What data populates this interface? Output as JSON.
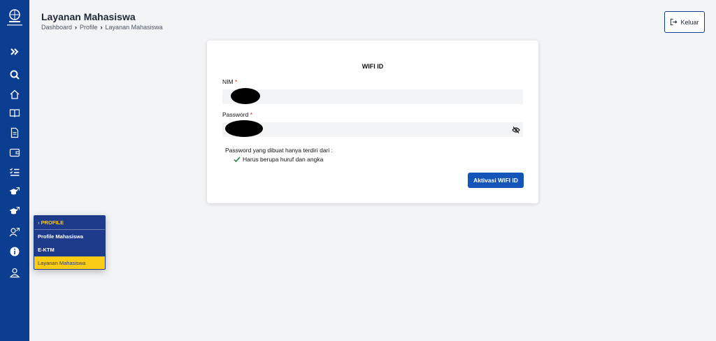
{
  "header": {
    "title": "Layanan Mahasiswa",
    "breadcrumb": [
      "Dashboard",
      "Profile",
      "Layanan Mahasiswa"
    ],
    "logout_label": "Keluar"
  },
  "sidebar": {
    "icons": [
      "expand-icon",
      "search-icon",
      "home-icon",
      "book-icon",
      "document-icon",
      "wallet-icon",
      "checklist-icon",
      "graduation-link-icon",
      "graduation-link-icon",
      "users-link-icon",
      "info-icon",
      "user-icon"
    ]
  },
  "form": {
    "title": "WIFI ID",
    "nim_label": "NIM",
    "password_label": "Password",
    "required_mark": "*",
    "rule_title": "Password yang dibuat hanya terdiri dari :",
    "rule_item": "Harus berupa huruf dan angka",
    "submit_label": "Aktivasi WIFI ID"
  },
  "popup_menu": {
    "header": "› PROFILE",
    "items": [
      {
        "label": "Profile Mahasiswa",
        "active": false
      },
      {
        "label": "E-KTM",
        "active": false
      },
      {
        "label": "Layanan Mahasiswa",
        "active": true
      }
    ]
  },
  "colors": {
    "sidebar": "#0b3d91",
    "primary_button": "#1554b8",
    "accent": "#facc15",
    "required": "#dc2626"
  }
}
